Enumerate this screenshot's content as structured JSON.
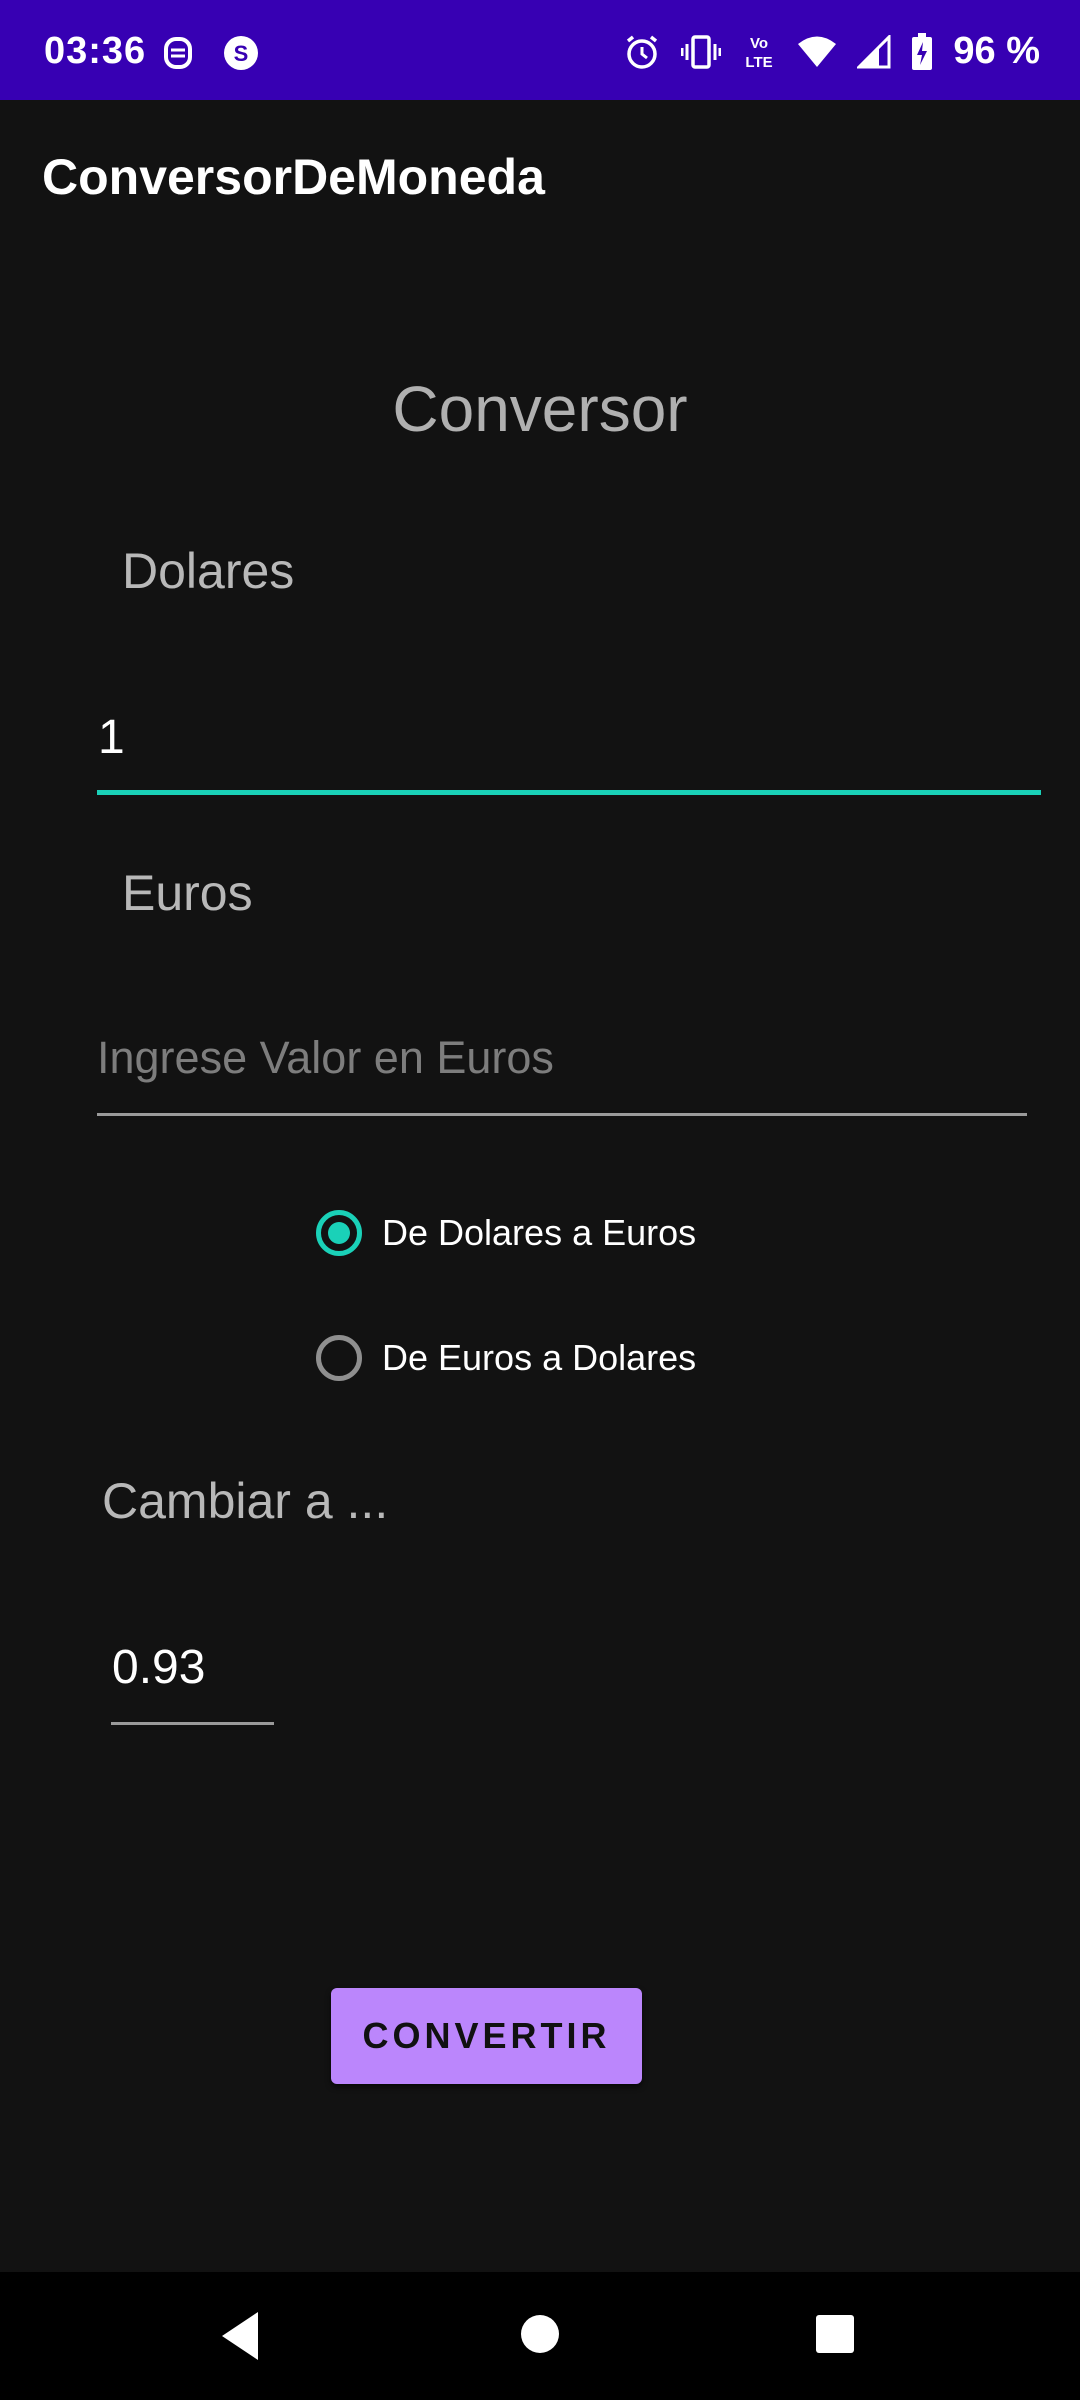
{
  "status_bar": {
    "time": "03:36",
    "battery": "96 %",
    "left_icons": [
      "notification-app-icon",
      "skype-icon"
    ],
    "right_icons": [
      "alarm-icon",
      "vibrate-icon",
      "volte-icon",
      "wifi-icon",
      "signal-icon",
      "battery-charging-icon"
    ],
    "volte_label_top": "Vo",
    "volte_label_bottom": "LTE"
  },
  "app_bar": {
    "title": "ConversorDeMoneda"
  },
  "main": {
    "heading": "Conversor",
    "dollars": {
      "label": "Dolares",
      "value": "1"
    },
    "euros": {
      "label": "Euros",
      "value": "",
      "placeholder": "Ingrese Valor en Euros"
    },
    "radio_options": [
      {
        "label": "De Dolares a Euros",
        "checked": true
      },
      {
        "label": "De Euros a Dolares",
        "checked": false
      }
    ],
    "rate": {
      "label": "Cambiar a ...",
      "value": "0.93"
    },
    "convert_button": "CONVERTIR"
  },
  "navigation": {
    "buttons": [
      "back-icon",
      "home-icon",
      "recents-icon"
    ]
  },
  "colors": {
    "status_bar": "#3700b3",
    "accent": "#1ad1b8",
    "button": "#bb86fc",
    "background": "#121212"
  }
}
